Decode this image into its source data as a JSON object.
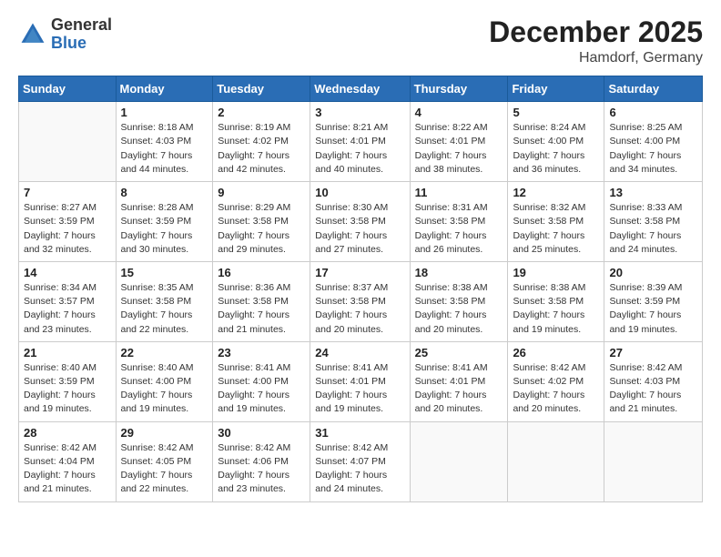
{
  "logo": {
    "general": "General",
    "blue": "Blue"
  },
  "title": "December 2025",
  "location": "Hamdorf, Germany",
  "days_of_week": [
    "Sunday",
    "Monday",
    "Tuesday",
    "Wednesday",
    "Thursday",
    "Friday",
    "Saturday"
  ],
  "weeks": [
    [
      {
        "day": "",
        "sunrise": "",
        "sunset": "",
        "daylight": ""
      },
      {
        "day": "1",
        "sunrise": "Sunrise: 8:18 AM",
        "sunset": "Sunset: 4:03 PM",
        "daylight": "Daylight: 7 hours and 44 minutes."
      },
      {
        "day": "2",
        "sunrise": "Sunrise: 8:19 AM",
        "sunset": "Sunset: 4:02 PM",
        "daylight": "Daylight: 7 hours and 42 minutes."
      },
      {
        "day": "3",
        "sunrise": "Sunrise: 8:21 AM",
        "sunset": "Sunset: 4:01 PM",
        "daylight": "Daylight: 7 hours and 40 minutes."
      },
      {
        "day": "4",
        "sunrise": "Sunrise: 8:22 AM",
        "sunset": "Sunset: 4:01 PM",
        "daylight": "Daylight: 7 hours and 38 minutes."
      },
      {
        "day": "5",
        "sunrise": "Sunrise: 8:24 AM",
        "sunset": "Sunset: 4:00 PM",
        "daylight": "Daylight: 7 hours and 36 minutes."
      },
      {
        "day": "6",
        "sunrise": "Sunrise: 8:25 AM",
        "sunset": "Sunset: 4:00 PM",
        "daylight": "Daylight: 7 hours and 34 minutes."
      }
    ],
    [
      {
        "day": "7",
        "sunrise": "Sunrise: 8:27 AM",
        "sunset": "Sunset: 3:59 PM",
        "daylight": "Daylight: 7 hours and 32 minutes."
      },
      {
        "day": "8",
        "sunrise": "Sunrise: 8:28 AM",
        "sunset": "Sunset: 3:59 PM",
        "daylight": "Daylight: 7 hours and 30 minutes."
      },
      {
        "day": "9",
        "sunrise": "Sunrise: 8:29 AM",
        "sunset": "Sunset: 3:58 PM",
        "daylight": "Daylight: 7 hours and 29 minutes."
      },
      {
        "day": "10",
        "sunrise": "Sunrise: 8:30 AM",
        "sunset": "Sunset: 3:58 PM",
        "daylight": "Daylight: 7 hours and 27 minutes."
      },
      {
        "day": "11",
        "sunrise": "Sunrise: 8:31 AM",
        "sunset": "Sunset: 3:58 PM",
        "daylight": "Daylight: 7 hours and 26 minutes."
      },
      {
        "day": "12",
        "sunrise": "Sunrise: 8:32 AM",
        "sunset": "Sunset: 3:58 PM",
        "daylight": "Daylight: 7 hours and 25 minutes."
      },
      {
        "day": "13",
        "sunrise": "Sunrise: 8:33 AM",
        "sunset": "Sunset: 3:58 PM",
        "daylight": "Daylight: 7 hours and 24 minutes."
      }
    ],
    [
      {
        "day": "14",
        "sunrise": "Sunrise: 8:34 AM",
        "sunset": "Sunset: 3:57 PM",
        "daylight": "Daylight: 7 hours and 23 minutes."
      },
      {
        "day": "15",
        "sunrise": "Sunrise: 8:35 AM",
        "sunset": "Sunset: 3:58 PM",
        "daylight": "Daylight: 7 hours and 22 minutes."
      },
      {
        "day": "16",
        "sunrise": "Sunrise: 8:36 AM",
        "sunset": "Sunset: 3:58 PM",
        "daylight": "Daylight: 7 hours and 21 minutes."
      },
      {
        "day": "17",
        "sunrise": "Sunrise: 8:37 AM",
        "sunset": "Sunset: 3:58 PM",
        "daylight": "Daylight: 7 hours and 20 minutes."
      },
      {
        "day": "18",
        "sunrise": "Sunrise: 8:38 AM",
        "sunset": "Sunset: 3:58 PM",
        "daylight": "Daylight: 7 hours and 20 minutes."
      },
      {
        "day": "19",
        "sunrise": "Sunrise: 8:38 AM",
        "sunset": "Sunset: 3:58 PM",
        "daylight": "Daylight: 7 hours and 19 minutes."
      },
      {
        "day": "20",
        "sunrise": "Sunrise: 8:39 AM",
        "sunset": "Sunset: 3:59 PM",
        "daylight": "Daylight: 7 hours and 19 minutes."
      }
    ],
    [
      {
        "day": "21",
        "sunrise": "Sunrise: 8:40 AM",
        "sunset": "Sunset: 3:59 PM",
        "daylight": "Daylight: 7 hours and 19 minutes."
      },
      {
        "day": "22",
        "sunrise": "Sunrise: 8:40 AM",
        "sunset": "Sunset: 4:00 PM",
        "daylight": "Daylight: 7 hours and 19 minutes."
      },
      {
        "day": "23",
        "sunrise": "Sunrise: 8:41 AM",
        "sunset": "Sunset: 4:00 PM",
        "daylight": "Daylight: 7 hours and 19 minutes."
      },
      {
        "day": "24",
        "sunrise": "Sunrise: 8:41 AM",
        "sunset": "Sunset: 4:01 PM",
        "daylight": "Daylight: 7 hours and 19 minutes."
      },
      {
        "day": "25",
        "sunrise": "Sunrise: 8:41 AM",
        "sunset": "Sunset: 4:01 PM",
        "daylight": "Daylight: 7 hours and 20 minutes."
      },
      {
        "day": "26",
        "sunrise": "Sunrise: 8:42 AM",
        "sunset": "Sunset: 4:02 PM",
        "daylight": "Daylight: 7 hours and 20 minutes."
      },
      {
        "day": "27",
        "sunrise": "Sunrise: 8:42 AM",
        "sunset": "Sunset: 4:03 PM",
        "daylight": "Daylight: 7 hours and 21 minutes."
      }
    ],
    [
      {
        "day": "28",
        "sunrise": "Sunrise: 8:42 AM",
        "sunset": "Sunset: 4:04 PM",
        "daylight": "Daylight: 7 hours and 21 minutes."
      },
      {
        "day": "29",
        "sunrise": "Sunrise: 8:42 AM",
        "sunset": "Sunset: 4:05 PM",
        "daylight": "Daylight: 7 hours and 22 minutes."
      },
      {
        "day": "30",
        "sunrise": "Sunrise: 8:42 AM",
        "sunset": "Sunset: 4:06 PM",
        "daylight": "Daylight: 7 hours and 23 minutes."
      },
      {
        "day": "31",
        "sunrise": "Sunrise: 8:42 AM",
        "sunset": "Sunset: 4:07 PM",
        "daylight": "Daylight: 7 hours and 24 minutes."
      },
      {
        "day": "",
        "sunrise": "",
        "sunset": "",
        "daylight": ""
      },
      {
        "day": "",
        "sunrise": "",
        "sunset": "",
        "daylight": ""
      },
      {
        "day": "",
        "sunrise": "",
        "sunset": "",
        "daylight": ""
      }
    ]
  ],
  "accent_color": "#2a6db5"
}
